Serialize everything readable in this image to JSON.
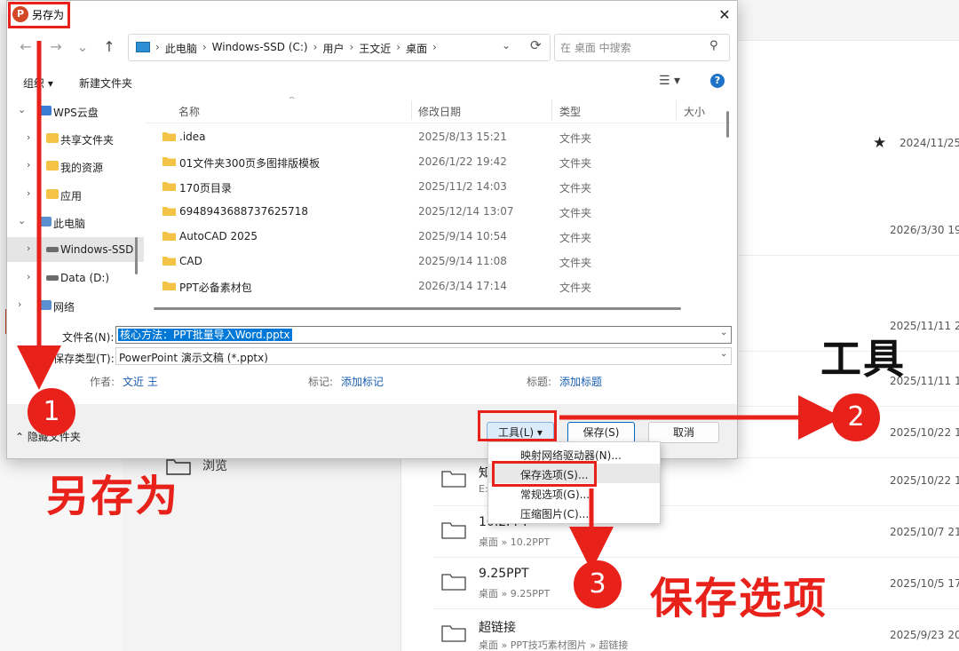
{
  "dialog": {
    "title": "另存为",
    "app_icon_glyph": "P",
    "nav": {
      "back": "←",
      "forward": "→",
      "recent": "⌄",
      "up": "↑"
    },
    "breadcrumb": [
      "此电脑",
      "Windows-SSD (C:)",
      "用户",
      "王文近",
      "桌面"
    ],
    "breadcrumb_sep": "›",
    "search_placeholder": "在 桌面 中搜索",
    "toolbar": {
      "organize": "组织 ▾",
      "new_folder": "新建文件夹",
      "help_glyph": "?"
    },
    "tree": [
      {
        "label": "WPS云盘",
        "chevron": "⌄"
      },
      {
        "label": "共享文件夹",
        "chevron": "›"
      },
      {
        "label": "我的资源",
        "chevron": "›"
      },
      {
        "label": "应用",
        "chevron": "›"
      },
      {
        "label": "此电脑",
        "chevron": "⌄"
      },
      {
        "label": "Windows-SSD",
        "chevron": "›"
      },
      {
        "label": "Data (D:)",
        "chevron": "›"
      },
      {
        "label": "网络",
        "chevron": "›"
      }
    ],
    "columns": {
      "name": "名称",
      "date": "修改日期",
      "type": "类型",
      "size": "大小"
    },
    "files": [
      {
        "name": ".idea",
        "date": "2025/8/13 15:21",
        "type": "文件夹"
      },
      {
        "name": "01文件夹300页多图排版模板",
        "date": "2026/1/22 19:42",
        "type": "文件夹"
      },
      {
        "name": "170页目录",
        "date": "2025/11/2 14:03",
        "type": "文件夹"
      },
      {
        "name": "6948943688737625718",
        "date": "2025/12/14 13:07",
        "type": "文件夹"
      },
      {
        "name": "AutoCAD 2025",
        "date": "2025/9/14 10:54",
        "type": "文件夹"
      },
      {
        "name": "CAD",
        "date": "2025/9/14 11:08",
        "type": "文件夹"
      },
      {
        "name": "PPT必备素材包",
        "date": "2026/3/14 17:14",
        "type": "文件夹"
      }
    ],
    "filename_label": "文件名(N):",
    "filename_value": "核心方法：PPT批量导入Word.pptx",
    "filetype_label": "保存类型(T):",
    "filetype_value": "PowerPoint 演示文稿 (*.pptx)",
    "author_label": "作者:",
    "author_value": "文近 王",
    "tags_label": "标记:",
    "tags_link": "添加标记",
    "title_label": "标题:",
    "title_link": "添加标题",
    "hide_folders": "⌃ 隐藏文件夹",
    "buttons": {
      "tools": "工具(L)  ▾",
      "save": "保存(S)",
      "cancel": "取消"
    },
    "tools_menu": [
      "映射网络驱动器(N)...",
      "保存选项(S)...",
      "常规选项(G)...",
      "压缩图片(C)..."
    ],
    "highlighted_menu_index": 1
  },
  "background": {
    "browse_label": "浏览",
    "star_glyph": "★",
    "top_date": "2024/11/25",
    "rows": [
      {
        "name": "",
        "path": "",
        "date": "2026/3/30 19"
      },
      {
        "name": "",
        "path": "",
        "date": "2025/11/11 2"
      },
      {
        "name": "",
        "path": "",
        "date": "2025/11/11 1"
      },
      {
        "name": "",
        "path": "",
        "date": "2025/10/22 1"
      },
      {
        "name": "知",
        "path": "E:",
        "date": "2025/10/22 1"
      },
      {
        "name": "10.2PPT",
        "path": "桌面 » 10.2PPT",
        "date": "2025/10/7 21"
      },
      {
        "name": "9.25PPT",
        "path": "桌面 » 9.25PPT",
        "date": "2025/10/5 17"
      },
      {
        "name": "超链接",
        "path": "桌面 » PPT技巧素材图片 » 超链接",
        "date": "2025/9/23 20"
      }
    ],
    "fragment_text": "t"
  },
  "annotations": {
    "steps": [
      "1",
      "2",
      "3"
    ],
    "label_save_as": "另存为",
    "label_tools": "工具",
    "label_save_options": "保存选项",
    "accent_color": "#e8211a"
  }
}
